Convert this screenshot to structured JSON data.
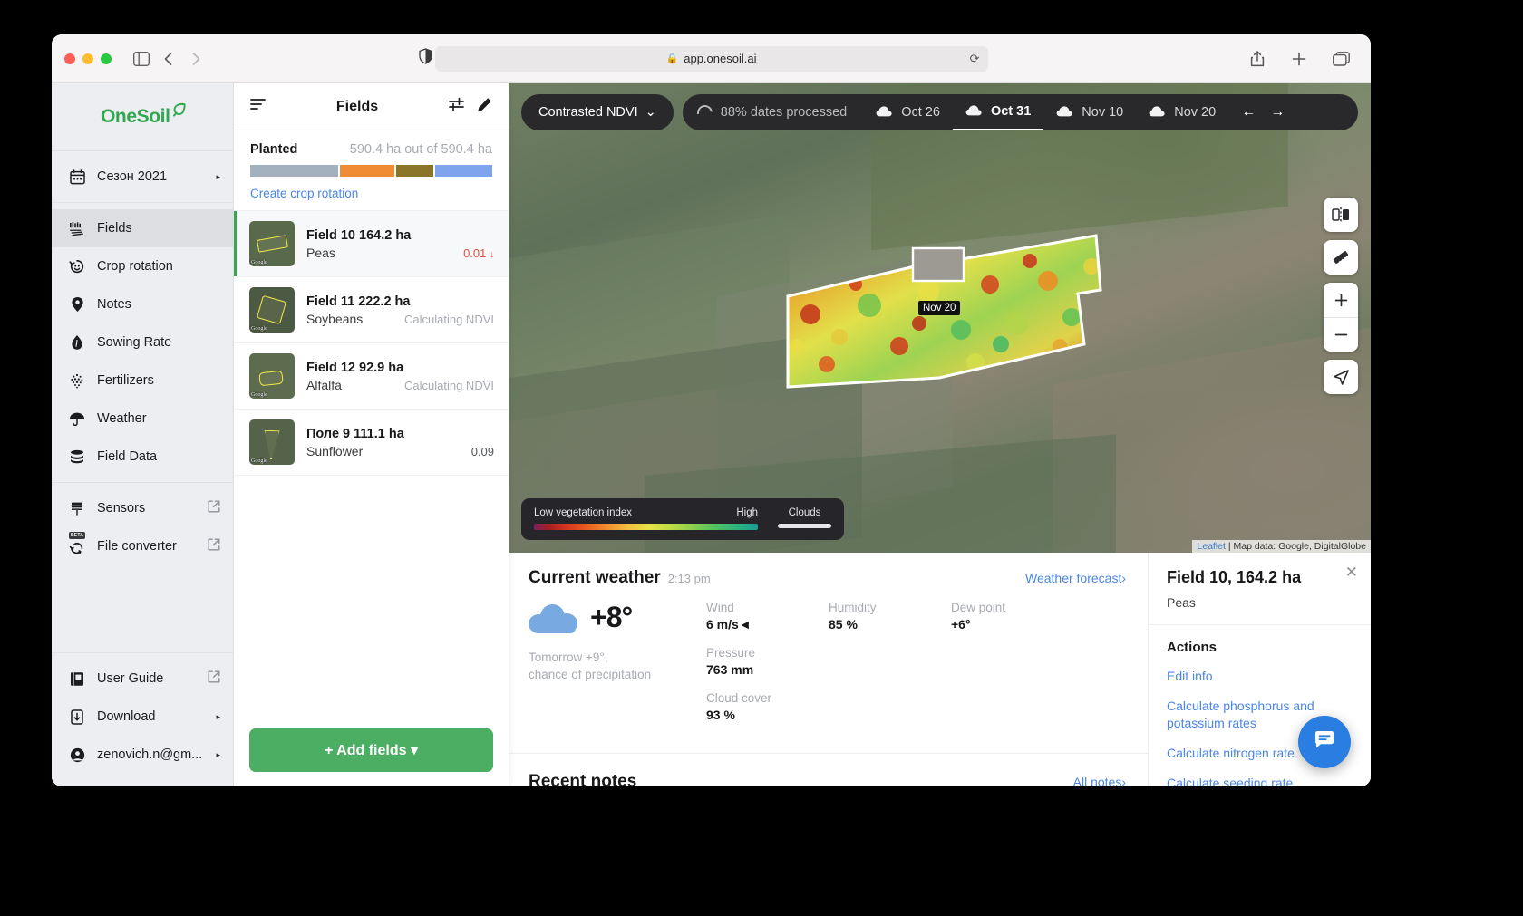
{
  "browser": {
    "url": "app.onesoil.ai",
    "lock_icon": "lock-icon",
    "reload_icon": "reload-icon",
    "back_icon": "chevron-left-icon",
    "forward_icon": "chevron-right-icon",
    "sidebar_toggle_icon": "sidebar-toggle-icon",
    "shield_icon": "shield-icon",
    "share_icon": "share-icon",
    "newtab_icon": "plus-icon",
    "tabs_icon": "tabs-icon"
  },
  "sidebar": {
    "logo": "OneSoil",
    "season": {
      "label": "Сезон 2021",
      "icon": "calendar-icon",
      "chevron": "▸"
    },
    "items": [
      {
        "label": "Fields",
        "icon": "fields-icon",
        "active": true
      },
      {
        "label": "Crop rotation",
        "icon": "crop-rotation-icon",
        "active": false
      },
      {
        "label": "Notes",
        "icon": "pin-icon",
        "active": false
      },
      {
        "label": "Sowing Rate",
        "icon": "seed-icon",
        "active": false
      },
      {
        "label": "Fertilizers",
        "icon": "fertilizer-icon",
        "active": false
      },
      {
        "label": "Weather",
        "icon": "umbrella-icon",
        "active": false
      },
      {
        "label": "Field Data",
        "icon": "database-icon",
        "active": false
      }
    ],
    "external_items": [
      {
        "label": "Sensors",
        "icon": "sensor-icon",
        "badge": ""
      },
      {
        "label": "File converter",
        "icon": "convert-icon",
        "badge": "BETA"
      }
    ],
    "footer_items": [
      {
        "label": "User Guide",
        "icon": "book-icon",
        "external": true
      },
      {
        "label": "Download",
        "icon": "download-icon",
        "chevron": "▸"
      },
      {
        "label": "zenovich.n@gm...",
        "icon": "avatar-icon",
        "chevron": "▸"
      }
    ]
  },
  "fields_panel": {
    "title": "Fields",
    "menu_icon": "list-icon",
    "filter_icon": "filter-icon",
    "edit_icon": "pencil-icon",
    "planted_label": "Planted",
    "planted_value": "590.4 ha out of 590.4 ha",
    "planted_segments": [
      {
        "color": "#a3b0bd",
        "pct": 37
      },
      {
        "color": "#ef8b32",
        "pct": 23
      },
      {
        "color": "#8a7427",
        "pct": 16
      },
      {
        "color": "#7fa4ee",
        "pct": 24
      }
    ],
    "crop_rotation_link": "Create crop rotation",
    "fields": [
      {
        "name": "Field 10 164.2 ha",
        "crop": "Peas",
        "ndvi": "0.01",
        "ndvi_style": "red",
        "arrow": "↓",
        "selected": true,
        "thumb_label": "Google"
      },
      {
        "name": "Field 11 222.2 ha",
        "crop": "Soybeans",
        "ndvi": "Calculating NDVI",
        "ndvi_style": "grey",
        "arrow": "",
        "selected": false,
        "thumb_label": "Google"
      },
      {
        "name": "Field 12 92.9 ha",
        "crop": "Alfalfa",
        "ndvi": "Calculating NDVI",
        "ndvi_style": "grey",
        "arrow": "",
        "selected": false,
        "thumb_label": "Google"
      },
      {
        "name": "Поле 9 111.1 ha",
        "crop": "Sunflower",
        "ndvi": "0.09",
        "ndvi_style": "dark",
        "arrow": "",
        "selected": false,
        "thumb_label": "Google"
      }
    ],
    "add_button": "+ Add fields",
    "add_button_caret": "▾"
  },
  "map": {
    "ndvi_mode": "Contrasted NDVI",
    "ndvi_caret": "⌄",
    "processing_text": "88% dates processed",
    "dates": [
      {
        "label": "Oct 26",
        "active": false,
        "cloud": true
      },
      {
        "label": "Oct 31",
        "active": true,
        "cloud": true
      },
      {
        "label": "Nov 10",
        "active": false,
        "cloud": true
      },
      {
        "label": "Nov 20",
        "active": false,
        "cloud": true
      }
    ],
    "nav_prev": "←",
    "nav_next": "→",
    "controls": [
      {
        "icon": "compare-icon"
      },
      {
        "icon": "ruler-icon"
      },
      {
        "icon": "zoom-in-icon",
        "label": "+"
      },
      {
        "icon": "zoom-out-icon",
        "label": "−"
      },
      {
        "icon": "locate-icon"
      }
    ],
    "field_marker": "Nov 20",
    "legend": {
      "low_label": "Low vegetation index",
      "high_label": "High",
      "clouds_label": "Clouds"
    },
    "attribution_link": "Leaflet",
    "attribution_text": " | Map data: Google, DigitalGlobe"
  },
  "weather": {
    "title": "Current weather",
    "time": "2:13 pm",
    "forecast_link": "Weather forecast›",
    "temperature": "+8°",
    "tomorrow": "Tomorrow +9°,\nchance of precipitation",
    "metrics": [
      {
        "key": "Wind",
        "value": "6 m/s◄"
      },
      {
        "key": "Humidity",
        "value": "85 %"
      },
      {
        "key": "Dew point",
        "value": "+6°"
      },
      {
        "key": "Pressure",
        "value": "763 mm"
      },
      {
        "key": "Cloud cover",
        "value": "93 %"
      }
    ]
  },
  "notes": {
    "title": "Recent notes",
    "all_link": "All notes›"
  },
  "field_panel": {
    "title": "Field 10, 164.2 ha",
    "crop": "Peas",
    "close_icon": "close-icon",
    "actions_title": "Actions",
    "actions": [
      "Edit info",
      "Calculate phosphorus and potassium rates",
      "Calculate nitrogen rate",
      "Calculate seeding rate"
    ]
  },
  "chat": {
    "icon": "chat-icon"
  },
  "colors": {
    "accent_green": "#4cae63",
    "link_blue": "#4a86e8",
    "ndvi_red": "#e8503a",
    "toolbar_dark": "#29292b"
  }
}
